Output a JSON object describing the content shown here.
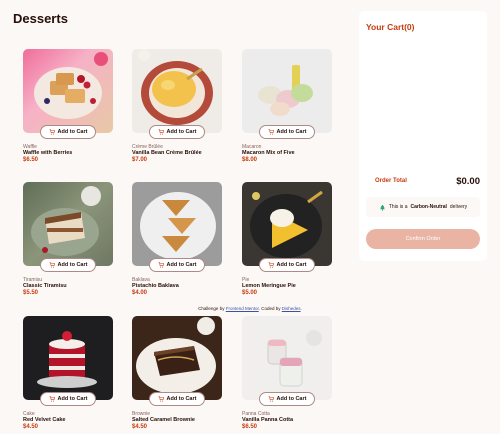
{
  "page": {
    "title": "Desserts"
  },
  "products": [
    {
      "category": "Waffle",
      "name": "Waffle with Berries",
      "price": "$6.50",
      "add_label": "Add to Cart"
    },
    {
      "category": "Crème Brûlée",
      "name": "Vanilla Bean Crème Brûlée",
      "price": "$7.00",
      "add_label": "Add to Cart"
    },
    {
      "category": "Macaron",
      "name": "Macaron Mix of Five",
      "price": "$8.00",
      "add_label": "Add to Cart"
    },
    {
      "category": "Tiramisu",
      "name": "Classic Tiramisu",
      "price": "$5.50",
      "add_label": "Add to Cart"
    },
    {
      "category": "Baklava",
      "name": "Pistachio Baklava",
      "price": "$4.00",
      "add_label": "Add to Cart"
    },
    {
      "category": "Pie",
      "name": "Lemon Meringue Pie",
      "price": "$5.00",
      "add_label": "Add to Cart"
    },
    {
      "category": "Cake",
      "name": "Red Velvet Cake",
      "price": "$4.50",
      "add_label": "Add to Cart"
    },
    {
      "category": "Brownie",
      "name": "Salted Caramel Brownie",
      "price": "$4.50",
      "add_label": "Add to Cart"
    },
    {
      "category": "Panna Cotta",
      "name": "Vanilla Panna Cotta",
      "price": "$6.50",
      "add_label": "Add to Cart"
    }
  ],
  "attribution": {
    "prefix": "Challenge by",
    "link1": "Frontend Mentor",
    "middle": ". Coded by",
    "link2": "Dishedes",
    "suffix": "."
  },
  "cart": {
    "title": "Your Cart(0)",
    "order_label": "Order Total",
    "order_total": "$0.00",
    "carbon_prefix": "This is a",
    "carbon_bold": "Carbon-Neutral",
    "carbon_suffix": "delivery",
    "confirm_label": "Confirm Order"
  },
  "colors": {
    "accent": "#c73b0f",
    "background": "#fcf8f6",
    "confirm_disabled": "#e9b4a3"
  },
  "icons": {
    "add": "cart-plus-icon",
    "carbon": "tree-icon"
  }
}
